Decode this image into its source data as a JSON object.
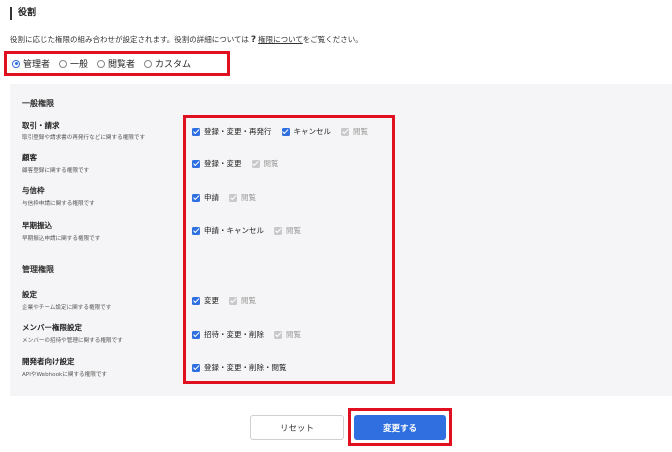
{
  "header": {
    "title": "役割"
  },
  "description": {
    "before": "役割に応じた権限の組み合わせが設定されます。役割の詳細については",
    "link": "権限について",
    "after": "をご覧ください。"
  },
  "roles": [
    {
      "label": "管理者",
      "selected": true
    },
    {
      "label": "一般",
      "selected": false
    },
    {
      "label": "閲覧者",
      "selected": false
    },
    {
      "label": "カスタム",
      "selected": false
    }
  ],
  "groups": {
    "general": {
      "title": "一般権限"
    },
    "admin": {
      "title": "管理権限"
    }
  },
  "permissions": [
    {
      "name": "取引・請求",
      "desc": "取引登録や請求書の再発行などに関する権限です",
      "options": [
        {
          "label": "登録・変更・再発行",
          "checked": true,
          "disabled": false
        },
        {
          "label": "キャンセル",
          "checked": true,
          "disabled": false
        },
        {
          "label": "閲覧",
          "checked": true,
          "disabled": true
        }
      ]
    },
    {
      "name": "顧客",
      "desc": "顧客登録に関する権限です",
      "options": [
        {
          "label": "登録・変更",
          "checked": true,
          "disabled": false
        },
        {
          "label": "閲覧",
          "checked": true,
          "disabled": true
        }
      ]
    },
    {
      "name": "与信枠",
      "desc": "与信枠申請に関する権限です",
      "options": [
        {
          "label": "申請",
          "checked": true,
          "disabled": false
        },
        {
          "label": "閲覧",
          "checked": true,
          "disabled": true
        }
      ]
    },
    {
      "name": "早期振込",
      "desc": "早期振込申請に関する権限です",
      "options": [
        {
          "label": "申請・キャンセル",
          "checked": true,
          "disabled": false
        },
        {
          "label": "閲覧",
          "checked": true,
          "disabled": true
        }
      ]
    },
    {
      "name": "設定",
      "desc": "企業やチーム設定に関する権限です",
      "options": [
        {
          "label": "変更",
          "checked": true,
          "disabled": false
        },
        {
          "label": "閲覧",
          "checked": true,
          "disabled": true
        }
      ]
    },
    {
      "name": "メンバー権限設定",
      "desc": "メンバーの招待や管理に関する権限です",
      "options": [
        {
          "label": "招待・変更・削除",
          "checked": true,
          "disabled": false
        },
        {
          "label": "閲覧",
          "checked": true,
          "disabled": true
        }
      ]
    },
    {
      "name": "開発者向け設定",
      "desc": "APIやWebhookに関する権限です",
      "options": [
        {
          "label": "登録・変更・削除・閲覧",
          "checked": true,
          "disabled": false
        }
      ]
    }
  ],
  "actions": {
    "reset_label": "リセット",
    "save_label": "変更する"
  },
  "colors": {
    "accent": "#2f6fe0",
    "highlight": "#e01020",
    "panel": "#f5f5f7"
  }
}
